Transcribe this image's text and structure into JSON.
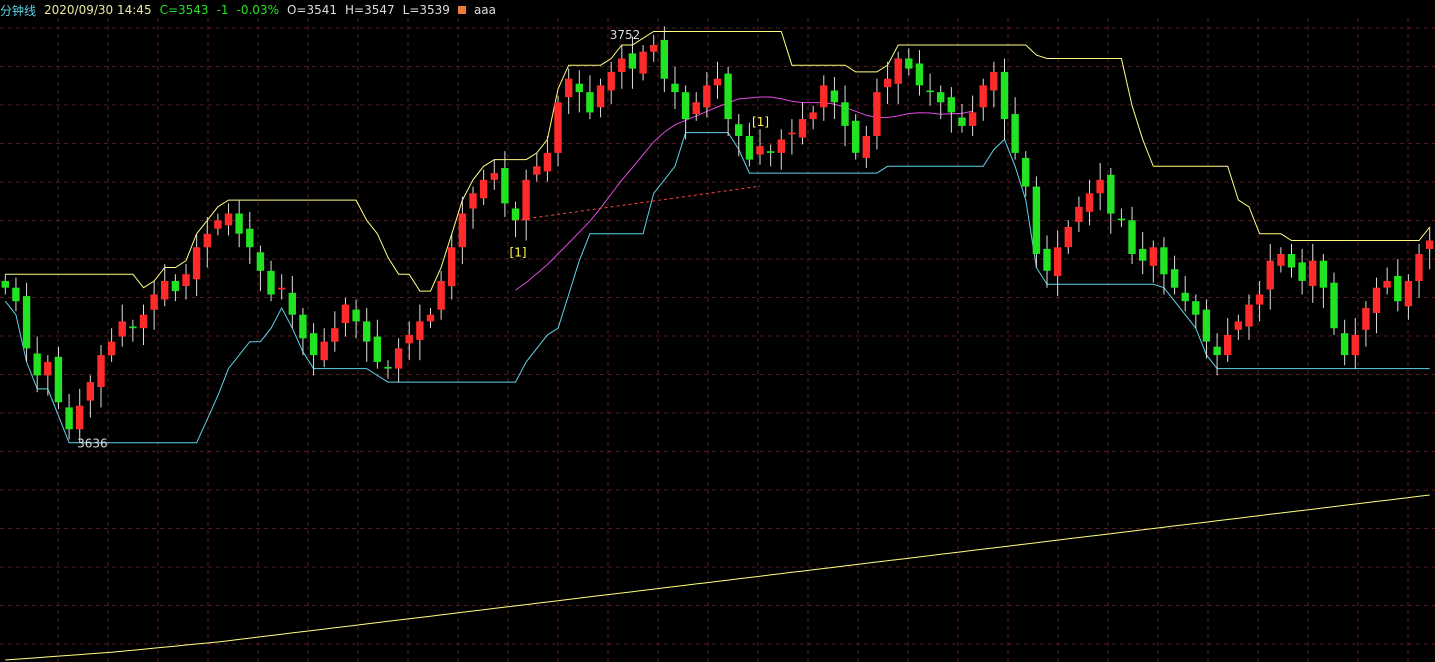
{
  "header": {
    "period": "分钟线",
    "datetime": "2020/09/30 14:45",
    "close": "C=3543",
    "change": "-1",
    "pct": "-0.03%",
    "open": "O=3541",
    "high": "H=3547",
    "low": "L=3539",
    "indicator": "aaa"
  },
  "colors": {
    "up": "#ff2a2a",
    "down": "#22e322",
    "upper_band": "#ffff80",
    "lower_band": "#5fd3e6",
    "signal_line": "#e14ae1",
    "volume_line": "#ffff80",
    "marker": "#ffff40",
    "grid": "#5a1b1b"
  },
  "chart_data": {
    "type": "candlestick",
    "price_ylim": [
      3620,
      3760
    ],
    "max_label": "3752",
    "min_label": "3636",
    "signal_labels": [
      "[1]",
      "[1]"
    ],
    "closes": [
      3680,
      3676,
      3662,
      3654,
      3658,
      3646,
      3638,
      3645,
      3652,
      3660,
      3664,
      3670,
      3668,
      3672,
      3678,
      3682,
      3679,
      3684,
      3692,
      3696,
      3700,
      3702,
      3696,
      3692,
      3685,
      3678,
      3680,
      3672,
      3665,
      3660,
      3664,
      3668,
      3675,
      3670,
      3664,
      3658,
      3656,
      3662,
      3666,
      3670,
      3672,
      3682,
      3692,
      3702,
      3708,
      3712,
      3714,
      3705,
      3700,
      3712,
      3716,
      3720,
      3735,
      3742,
      3738,
      3732,
      3740,
      3744,
      3748,
      3745,
      3750,
      3752,
      3742,
      3738,
      3730,
      3735,
      3740,
      3742,
      3730,
      3725,
      3718,
      3722,
      3720,
      3724,
      3726,
      3730,
      3732,
      3740,
      3735,
      3728,
      3720,
      3725,
      3738,
      3742,
      3748,
      3745,
      3740,
      3738,
      3735,
      3732,
      3728,
      3732,
      3740,
      3744,
      3730,
      3720,
      3710,
      3690,
      3685,
      3692,
      3698,
      3704,
      3708,
      3712,
      3702,
      3700,
      3690,
      3688,
      3692,
      3684,
      3680,
      3676,
      3672,
      3664,
      3660,
      3666,
      3670,
      3675,
      3678,
      3688,
      3690,
      3686,
      3682,
      3688,
      3680,
      3668,
      3660,
      3666,
      3674,
      3680,
      3682,
      3676,
      3682,
      3690,
      3694
    ],
    "volume_indicator": [
      0.0,
      0.3,
      0.6,
      0.9,
      1.2,
      1.5,
      1.8,
      2.1,
      2.4,
      2.7,
      3.0,
      3.4,
      3.8,
      4.2,
      4.6,
      5.0,
      5.4,
      5.8,
      6.2,
      6.6,
      7.0,
      7.5,
      8.0,
      8.5,
      9.0,
      9.5,
      10.0,
      10.5,
      11.0,
      11.5,
      12.0,
      12.5,
      13.0,
      13.5,
      14.0,
      14.5,
      15.0,
      15.5,
      16.0,
      16.5,
      17.0,
      17.5,
      18.0,
      18.5,
      19.0,
      19.5,
      20.0,
      20.5,
      21.0,
      21.5,
      22.0,
      22.5,
      23.0,
      23.5,
      24.0,
      24.5,
      25.0,
      25.5,
      26.0,
      26.5,
      27.0,
      27.5,
      28.0,
      28.5,
      29.0,
      29.5,
      30.0,
      30.5,
      31.0,
      31.5,
      32.0,
      32.5,
      33.0,
      33.5,
      34.0,
      34.5,
      35.0,
      35.5,
      36.0,
      36.5,
      37.0,
      37.5,
      38.0,
      38.5,
      39.0,
      39.5,
      40.0,
      40.5,
      41.0,
      41.5,
      42.0,
      42.5,
      43.0,
      43.5,
      44.0,
      44.5,
      45.0,
      45.5,
      46.0,
      46.5,
      47.0,
      47.5,
      48.0,
      48.5,
      49.0,
      49.5,
      50.0,
      50.5,
      51.0,
      51.5,
      52.0,
      52.5,
      53.0,
      53.5,
      54.0,
      54.5,
      55.0,
      55.5,
      56.0,
      56.5,
      57.0,
      57.5,
      58.0,
      58.5,
      59.0,
      59.5,
      60.0,
      60.5,
      61.0,
      61.5,
      62.0,
      62.5,
      63.0,
      63.5,
      64.0
    ]
  }
}
